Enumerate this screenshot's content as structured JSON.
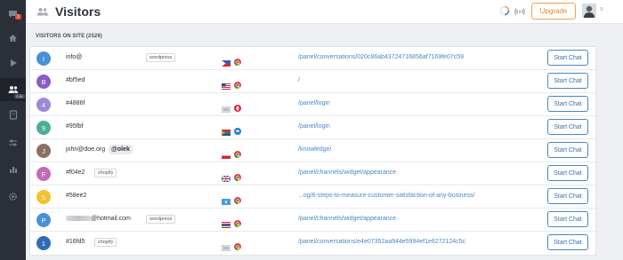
{
  "sidebar": {
    "badge": "1",
    "visitors_count": "2.5k",
    "items": [
      {
        "name": "chat-icon"
      },
      {
        "name": "home-icon"
      },
      {
        "name": "play-icon"
      },
      {
        "name": "visitors-icon"
      },
      {
        "name": "book-icon"
      },
      {
        "name": "sliders-icon"
      },
      {
        "name": "stats-icon"
      },
      {
        "name": "settings-icon"
      }
    ]
  },
  "header": {
    "title": "Visitors",
    "upgrade_label": "Upgrade",
    "chevron": "≡"
  },
  "section": {
    "label": "VISITORS ON SITE (2526)"
  },
  "visitors": [
    {
      "initial": "I",
      "color": "#4a90d9",
      "name": "info@",
      "tag": "wordpress",
      "flag": "ph",
      "browser": "chrome",
      "url": "/panel/conversations/020c86ab43724716856af7169fe07c59",
      "action": "Start Chat"
    },
    {
      "initial": "B",
      "color": "#8a5cc6",
      "name": "#bf5ed",
      "tag": "",
      "flag": "us",
      "browser": "chrome",
      "url": "/",
      "action": "Start Chat"
    },
    {
      "initial": "4",
      "color": "#9b8bd6",
      "name": "#4886f",
      "tag": "",
      "flag": "generic",
      "browser": "opera",
      "url": "/panel/login",
      "action": "Start Chat"
    },
    {
      "initial": "9",
      "color": "#4cae98",
      "name": "#95fbf",
      "tag": "",
      "flag": "za",
      "browser": "edge",
      "url": "/panel/login",
      "action": "Start Chat"
    },
    {
      "initial": "J",
      "color": "#8a7060",
      "name": "john@doe.org",
      "tag": "",
      "mention": "@olek",
      "flag": "pl",
      "browser": "chrome",
      "url": "/knowledge/",
      "action": "Start Chat"
    },
    {
      "initial": "F",
      "color": "#c56ab8",
      "name": "#f04e2",
      "tag": "shopify",
      "flag": "gb",
      "browser": "chrome",
      "url": "/panel/channels/widget/appearance",
      "action": "Start Chat"
    },
    {
      "initial": "5",
      "color": "#f2c230",
      "name": "#58ee2",
      "tag": "",
      "flag": "so",
      "browser": "chrome",
      "url": "...og/6-steps-to-measure-customer-satisfaction-of-any-business/",
      "action": "Start Chat"
    },
    {
      "initial": "P",
      "color": "#4a90d9",
      "name": "@hotmail.com",
      "tag": "wordpress",
      "flag": "th",
      "browser": "chrome",
      "url": "/panel/channels/widget/appearance",
      "action": "Start Chat"
    },
    {
      "initial": "1",
      "color": "#2f6db5",
      "name": "#16fd5",
      "tag": "shopify",
      "flag": "generic",
      "browser": "chrome",
      "url": "/panel/conversations/e4e07352aa944e5994ef1e6272124c5c",
      "action": "Start Chat"
    }
  ]
}
